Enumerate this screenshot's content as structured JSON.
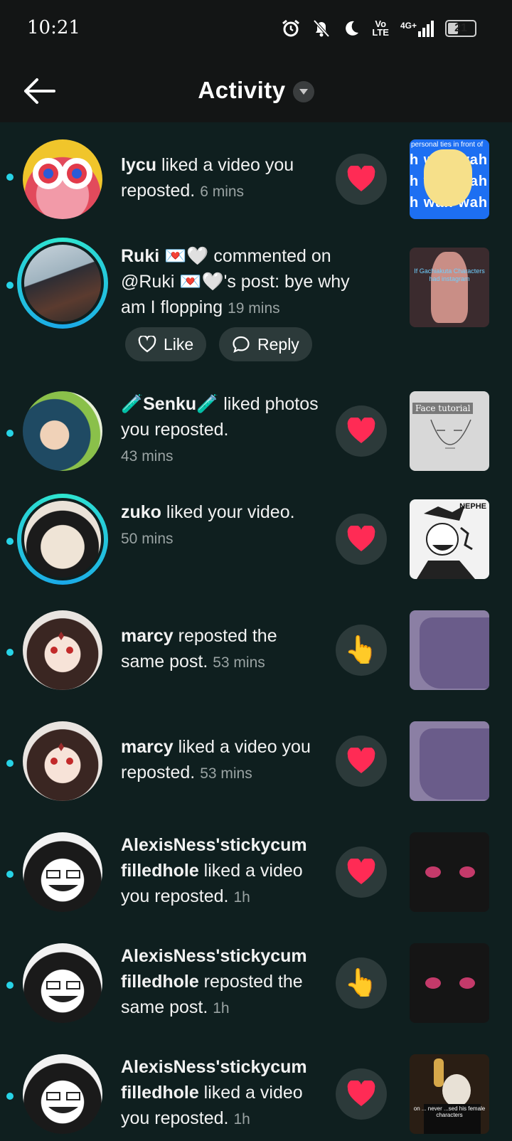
{
  "status_bar": {
    "time": "10:21",
    "lte_label": "Vo\nLTE",
    "network_label": "4G+",
    "battery": "21"
  },
  "header": {
    "title": "Activity"
  },
  "colors": {
    "background": "#0f1f1f",
    "unread_dot": "#27d3e6",
    "heart": "#ff2b55",
    "ring": "#2fe6cf"
  },
  "notifications": [
    {
      "username": "lycu",
      "message": " liked a video you reposted. ",
      "time": "6 mins",
      "action_icon": "heart-icon"
    },
    {
      "username": "Ruki 💌🤍",
      "message": " commented on @Ruki 💌🤍's post: bye why am I flopping ",
      "time": "19 mins",
      "like_label": "Like",
      "reply_label": "Reply"
    },
    {
      "username": "🧪Senku🧪",
      "message": " liked photos you reposted. ",
      "time": "43 mins",
      "action_icon": "heart-icon"
    },
    {
      "username": "zuko",
      "message": " liked your video. ",
      "time": "50 mins",
      "action_icon": "heart-icon"
    },
    {
      "username": "marcy",
      "message": " reposted the same post. ",
      "time": "53 mins",
      "action_icon": "pointing-hand-icon"
    },
    {
      "username": "marcy",
      "message": " liked a video you reposted. ",
      "time": "53 mins",
      "action_icon": "heart-icon"
    },
    {
      "username": "AlexisNess'stickycum filledhole",
      "message": " liked a video you reposted. ",
      "time": "1h",
      "action_icon": "heart-icon"
    },
    {
      "username": "AlexisNess'stickycum filledhole",
      "message": " reposted the same post. ",
      "time": "1h",
      "action_icon": "pointing-hand-icon"
    },
    {
      "username": "AlexisNess'stickycum filledhole",
      "message": " liked a video you reposted. ",
      "time": "1h",
      "action_icon": "heart-icon"
    }
  ],
  "thumbnail_text": {
    "t1_top": "personal ties in front of",
    "t1_wah": "h wah wah",
    "t2": "If Gachiakuta Characters had instagram",
    "t3": "Face tutorial",
    "t4": "NEPHE",
    "t9": "on ... never ...sed his female characters"
  }
}
